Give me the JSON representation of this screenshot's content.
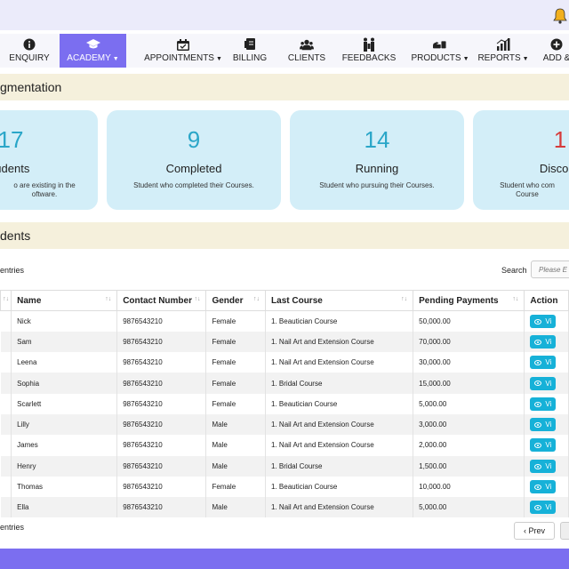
{
  "nav": {
    "items": [
      {
        "label": "ENQUIRY",
        "icon": "info-icon",
        "active": false,
        "dropdown": false
      },
      {
        "label": "ACADEMY",
        "icon": "graduation-cap-icon",
        "active": true,
        "dropdown": true
      },
      {
        "label": "APPOINTMENTS",
        "icon": "calendar-icon",
        "active": false,
        "dropdown": true
      },
      {
        "label": "BILLING",
        "icon": "billing-icon",
        "active": false,
        "dropdown": false
      },
      {
        "label": "CLIENTS",
        "icon": "clients-icon",
        "active": false,
        "dropdown": false
      },
      {
        "label": "FEEDBACKS",
        "icon": "feedback-icon",
        "active": false,
        "dropdown": false
      },
      {
        "label": "PRODUCTS",
        "icon": "products-icon",
        "active": false,
        "dropdown": true
      },
      {
        "label": "REPORTS",
        "icon": "reports-icon",
        "active": false,
        "dropdown": true
      },
      {
        "label": "ADD &",
        "icon": "add-icon",
        "active": false,
        "dropdown": false
      }
    ],
    "active_color": "#7b6ef0"
  },
  "segmentation": {
    "title": "gmentation",
    "cards": [
      {
        "number": "17",
        "label": "tudents",
        "description": "o are existing in the oftware.",
        "accent": "#2aa6c8"
      },
      {
        "number": "9",
        "label": "Completed",
        "description": "Student who completed their Courses.",
        "accent": "#2aa6c8"
      },
      {
        "number": "14",
        "label": "Running",
        "description": "Student who pursuing their Courses.",
        "accent": "#2aa6c8"
      },
      {
        "number": "1",
        "label": "Disconti",
        "description": "Student who com Course",
        "accent": "#d63b3b"
      }
    ]
  },
  "students": {
    "title": "dents",
    "entries_top": "entries",
    "search_label": "Search",
    "search_placeholder": "Please E",
    "columns": [
      "",
      "Name",
      "Contact Number",
      "Gender",
      "Last Course",
      "Pending Payments",
      "Action"
    ],
    "view_label": "Vi",
    "rows": [
      {
        "name": "Nick",
        "contact": "9876543210",
        "gender": "Female",
        "course": "1. Beautician Course",
        "pending": "50,000.00"
      },
      {
        "name": "Sam",
        "contact": "9876543210",
        "gender": "Female",
        "course": "1. Nail Art and Extension Course",
        "pending": "70,000.00"
      },
      {
        "name": "Leena",
        "contact": "9876543210",
        "gender": "Female",
        "course": "1. Nail Art and Extension Course",
        "pending": "30,000.00"
      },
      {
        "name": "Sophia",
        "contact": "9876543210",
        "gender": "Female",
        "course": "1. Bridal Course",
        "pending": "15,000.00"
      },
      {
        "name": "Scarlett",
        "contact": "9876543210",
        "gender": "Female",
        "course": "1. Beautician Course",
        "pending": "5,000.00"
      },
      {
        "name": "Lilly",
        "contact": "9876543210",
        "gender": "Male",
        "course": "1. Nail Art and Extension Course",
        "pending": "3,000.00"
      },
      {
        "name": "James",
        "contact": "9876543210",
        "gender": "Male",
        "course": "1. Nail Art and Extension Course",
        "pending": "2,000.00"
      },
      {
        "name": "Henry",
        "contact": "9876543210",
        "gender": "Male",
        "course": "1. Bridal Course",
        "pending": "1,500.00"
      },
      {
        "name": "Thomas",
        "contact": "9876543210",
        "gender": "Female",
        "course": "1. Beautician Course",
        "pending": "10,000.00"
      },
      {
        "name": "Ella",
        "contact": "9876543210",
        "gender": "Male",
        "course": "1. Nail Art and Extension Course",
        "pending": "5,000.00"
      }
    ],
    "entries_bottom": "entries",
    "prev_label": "‹ Prev"
  }
}
